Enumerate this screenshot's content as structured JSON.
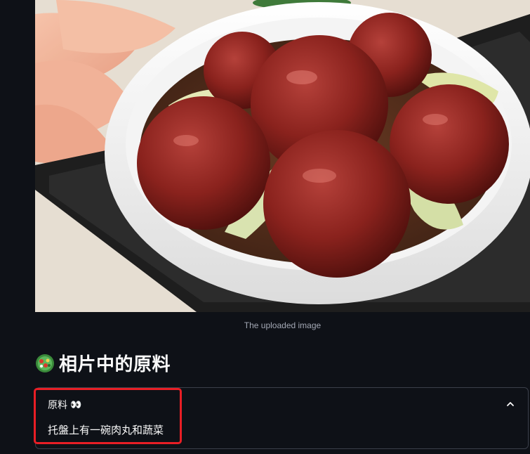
{
  "image": {
    "alt": "The uploaded image",
    "caption": "The uploaded image"
  },
  "section": {
    "icon": "salad-bowl-icon",
    "title": "相片中的原料"
  },
  "expander": {
    "label": "原料",
    "label_emoji": "👀",
    "expanded": true,
    "body": "托盤上有一碗肉丸和蔬菜"
  },
  "colors": {
    "background": "#0e1117",
    "text": "#fafafa",
    "caption": "#a3a8b4",
    "border": "#3b3f4a",
    "highlight": "#e81e25"
  }
}
